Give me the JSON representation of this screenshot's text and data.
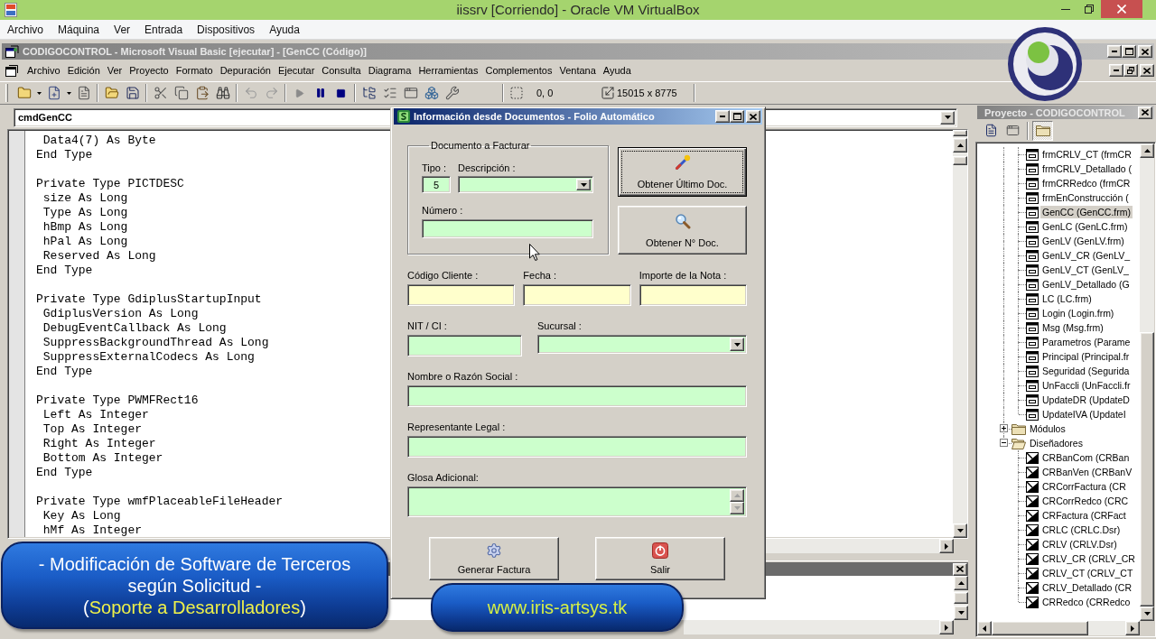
{
  "vbox_window": {
    "title": "iissrv [Corriendo] - Oracle VM VirtualBox",
    "menu": [
      "Archivo",
      "Máquina",
      "Ver",
      "Entrada",
      "Dispositivos",
      "Ayuda"
    ]
  },
  "ide": {
    "title": "CODIGOCONTROL - Microsoft Visual Basic [ejecutar] - [GenCC (Código)]",
    "menu": [
      "Archivo",
      "Edición",
      "Ver",
      "Proyecto",
      "Formato",
      "Depuración",
      "Ejecutar",
      "Consulta",
      "Diagrama",
      "Herramientas",
      "Complementos",
      "Ventana",
      "Ayuda"
    ],
    "toolbar": {
      "position": "0, 0",
      "size": "15015 x 8775"
    }
  },
  "code_window": {
    "object_combo": "cmdGenCC",
    "blocks": [
      [
        " Data4(7) As Byte",
        "End Type"
      ],
      [
        "Private Type PICTDESC",
        " size As Long",
        " Type As Long",
        " hBmp As Long",
        " hPal As Long",
        " Reserved As Long",
        "End Type"
      ],
      [
        "Private Type GdiplusStartupInput",
        " GdiplusVersion As Long",
        " DebugEventCallback As Long",
        " SuppressBackgroundThread As Long",
        " SuppressExternalCodecs As Long",
        "End Type"
      ],
      [
        "Private Type PWMFRect16",
        " Left As Integer",
        " Top As Integer",
        " Right As Integer",
        " Bottom As Integer",
        "End Type"
      ],
      [
        "Private Type wmfPlaceableFileHeader",
        " Key As Long",
        " hMf As Integer"
      ]
    ]
  },
  "project_explorer": {
    "title": "Proyecto - CODIGOCONTROL",
    "toolbar_buttons": [
      {
        "pressed": false
      },
      {
        "pressed": false
      },
      {
        "pressed": true
      }
    ],
    "items": [
      {
        "label": "frmCRLV_CT (frmCR",
        "kind": "form",
        "selected": false
      },
      {
        "label": "frmCRLV_Detallado (",
        "kind": "form",
        "selected": false
      },
      {
        "label": "frmCRRedco (frmCR",
        "kind": "form",
        "selected": false
      },
      {
        "label": "frmEnConstrucción (",
        "kind": "form",
        "selected": false
      },
      {
        "label": "GenCC (GenCC.frm)",
        "kind": "form",
        "selected": true
      },
      {
        "label": "GenLC (GenLC.frm)",
        "kind": "form",
        "selected": false
      },
      {
        "label": "GenLV (GenLV.frm)",
        "kind": "form",
        "selected": false
      },
      {
        "label": "GenLV_CR (GenLV_",
        "kind": "form",
        "selected": false
      },
      {
        "label": "GenLV_CT (GenLV_",
        "kind": "form",
        "selected": false
      },
      {
        "label": "GenLV_Detallado (G",
        "kind": "form",
        "selected": false
      },
      {
        "label": "LC (LC.frm)",
        "kind": "form",
        "selected": false
      },
      {
        "label": "Login (Login.frm)",
        "kind": "form",
        "selected": false
      },
      {
        "label": "Msg (Msg.frm)",
        "kind": "form",
        "selected": false
      },
      {
        "label": "Parametros (Parame",
        "kind": "form",
        "selected": false
      },
      {
        "label": "Principal (Principal.fr",
        "kind": "form",
        "selected": false
      },
      {
        "label": "Seguridad (Segurida",
        "kind": "form",
        "selected": false
      },
      {
        "label": "UnFaccli (UnFaccli.fr",
        "kind": "form",
        "selected": false
      },
      {
        "label": "UpdateDR (UpdateD",
        "kind": "form",
        "selected": false
      },
      {
        "label": "UpdateIVA (UpdateI",
        "kind": "form",
        "selected": false
      }
    ],
    "folders": [
      {
        "label": "Módulos",
        "expanded": false
      },
      {
        "label": "Diseñadores",
        "expanded": true,
        "children": [
          {
            "label": "CRBanCom (CRBan",
            "kind": "designer",
            "selected": false
          },
          {
            "label": "CRBanVen (CRBanV",
            "kind": "designer",
            "selected": false
          },
          {
            "label": "CRCorrFactura (CR",
            "kind": "designer",
            "selected": false
          },
          {
            "label": "CRCorrRedco (CRC",
            "kind": "designer",
            "selected": false
          },
          {
            "label": "CRFactura (CRFact",
            "kind": "designer",
            "selected": false
          },
          {
            "label": "CRLC (CRLC.Dsr)",
            "kind": "designer",
            "selected": false
          },
          {
            "label": "CRLV (CRLV.Dsr)",
            "kind": "designer",
            "selected": false
          },
          {
            "label": "CRLV_CR (CRLV_CR",
            "kind": "designer",
            "selected": false
          },
          {
            "label": "CRLV_CT (CRLV_CT",
            "kind": "designer",
            "selected": false
          },
          {
            "label": "CRLV_Detallado (CR",
            "kind": "designer",
            "selected": false
          },
          {
            "label": "CRRedco (CRRedco",
            "kind": "designer",
            "selected": false
          }
        ]
      }
    ]
  },
  "dialog": {
    "title": "Información desde Documentos - Folio Automático",
    "group": {
      "legend": "Documento a Facturar",
      "fields": [
        {
          "label": "Tipo :",
          "kind": "text",
          "value": "5",
          "color": "#ccffcc"
        },
        {
          "label": "Descripción :",
          "kind": "combo",
          "color": "#ccffcc"
        },
        {
          "label": "Número :",
          "kind": "text",
          "color": "#ccffcc"
        }
      ]
    },
    "side_buttons": [
      {
        "label": "Obtener Último Doc.",
        "focused": true
      },
      {
        "label": "Obtener N° Doc.",
        "focused": false
      }
    ],
    "field_rows": [
      [
        {
          "label": "Código Cliente :",
          "kind": "text",
          "color": "#ffffcc"
        },
        {
          "label": "Fecha :",
          "kind": "text",
          "color": "#ffffcc"
        },
        {
          "label": "Importe de la Nota :",
          "kind": "text",
          "color": "#ffffcc"
        }
      ],
      [
        {
          "label": "NIT / CI :",
          "kind": "text",
          "color": "#ccffcc"
        },
        {
          "label": "Sucursal :",
          "kind": "combo",
          "color": "#ccffcc"
        }
      ],
      [
        {
          "label": "Nombre o Razón Social :",
          "kind": "text",
          "color": "#ccffcc"
        }
      ],
      [
        {
          "label": "Representante Legal :",
          "kind": "text",
          "color": "#ccffcc"
        }
      ],
      [
        {
          "label": "Glosa Adicional:",
          "kind": "memo",
          "color": "#ccffcc"
        }
      ]
    ],
    "buttons": [
      {
        "label": "Generar Factura"
      },
      {
        "label": "Salir"
      }
    ]
  },
  "promo_banner": {
    "lines": [
      [
        {
          "text": "- Modificación de Software de Terceros",
          "highlight": false
        }
      ],
      [
        {
          "text": "según Solicitud -",
          "highlight": false
        }
      ],
      [
        {
          "text": "(",
          "highlight": false
        },
        {
          "text": "Soporte a Desarrolladores",
          "highlight": true
        },
        {
          "text": ")",
          "highlight": false
        }
      ]
    ]
  },
  "website_banner": {
    "text": "www.iris-artsys.tk"
  }
}
